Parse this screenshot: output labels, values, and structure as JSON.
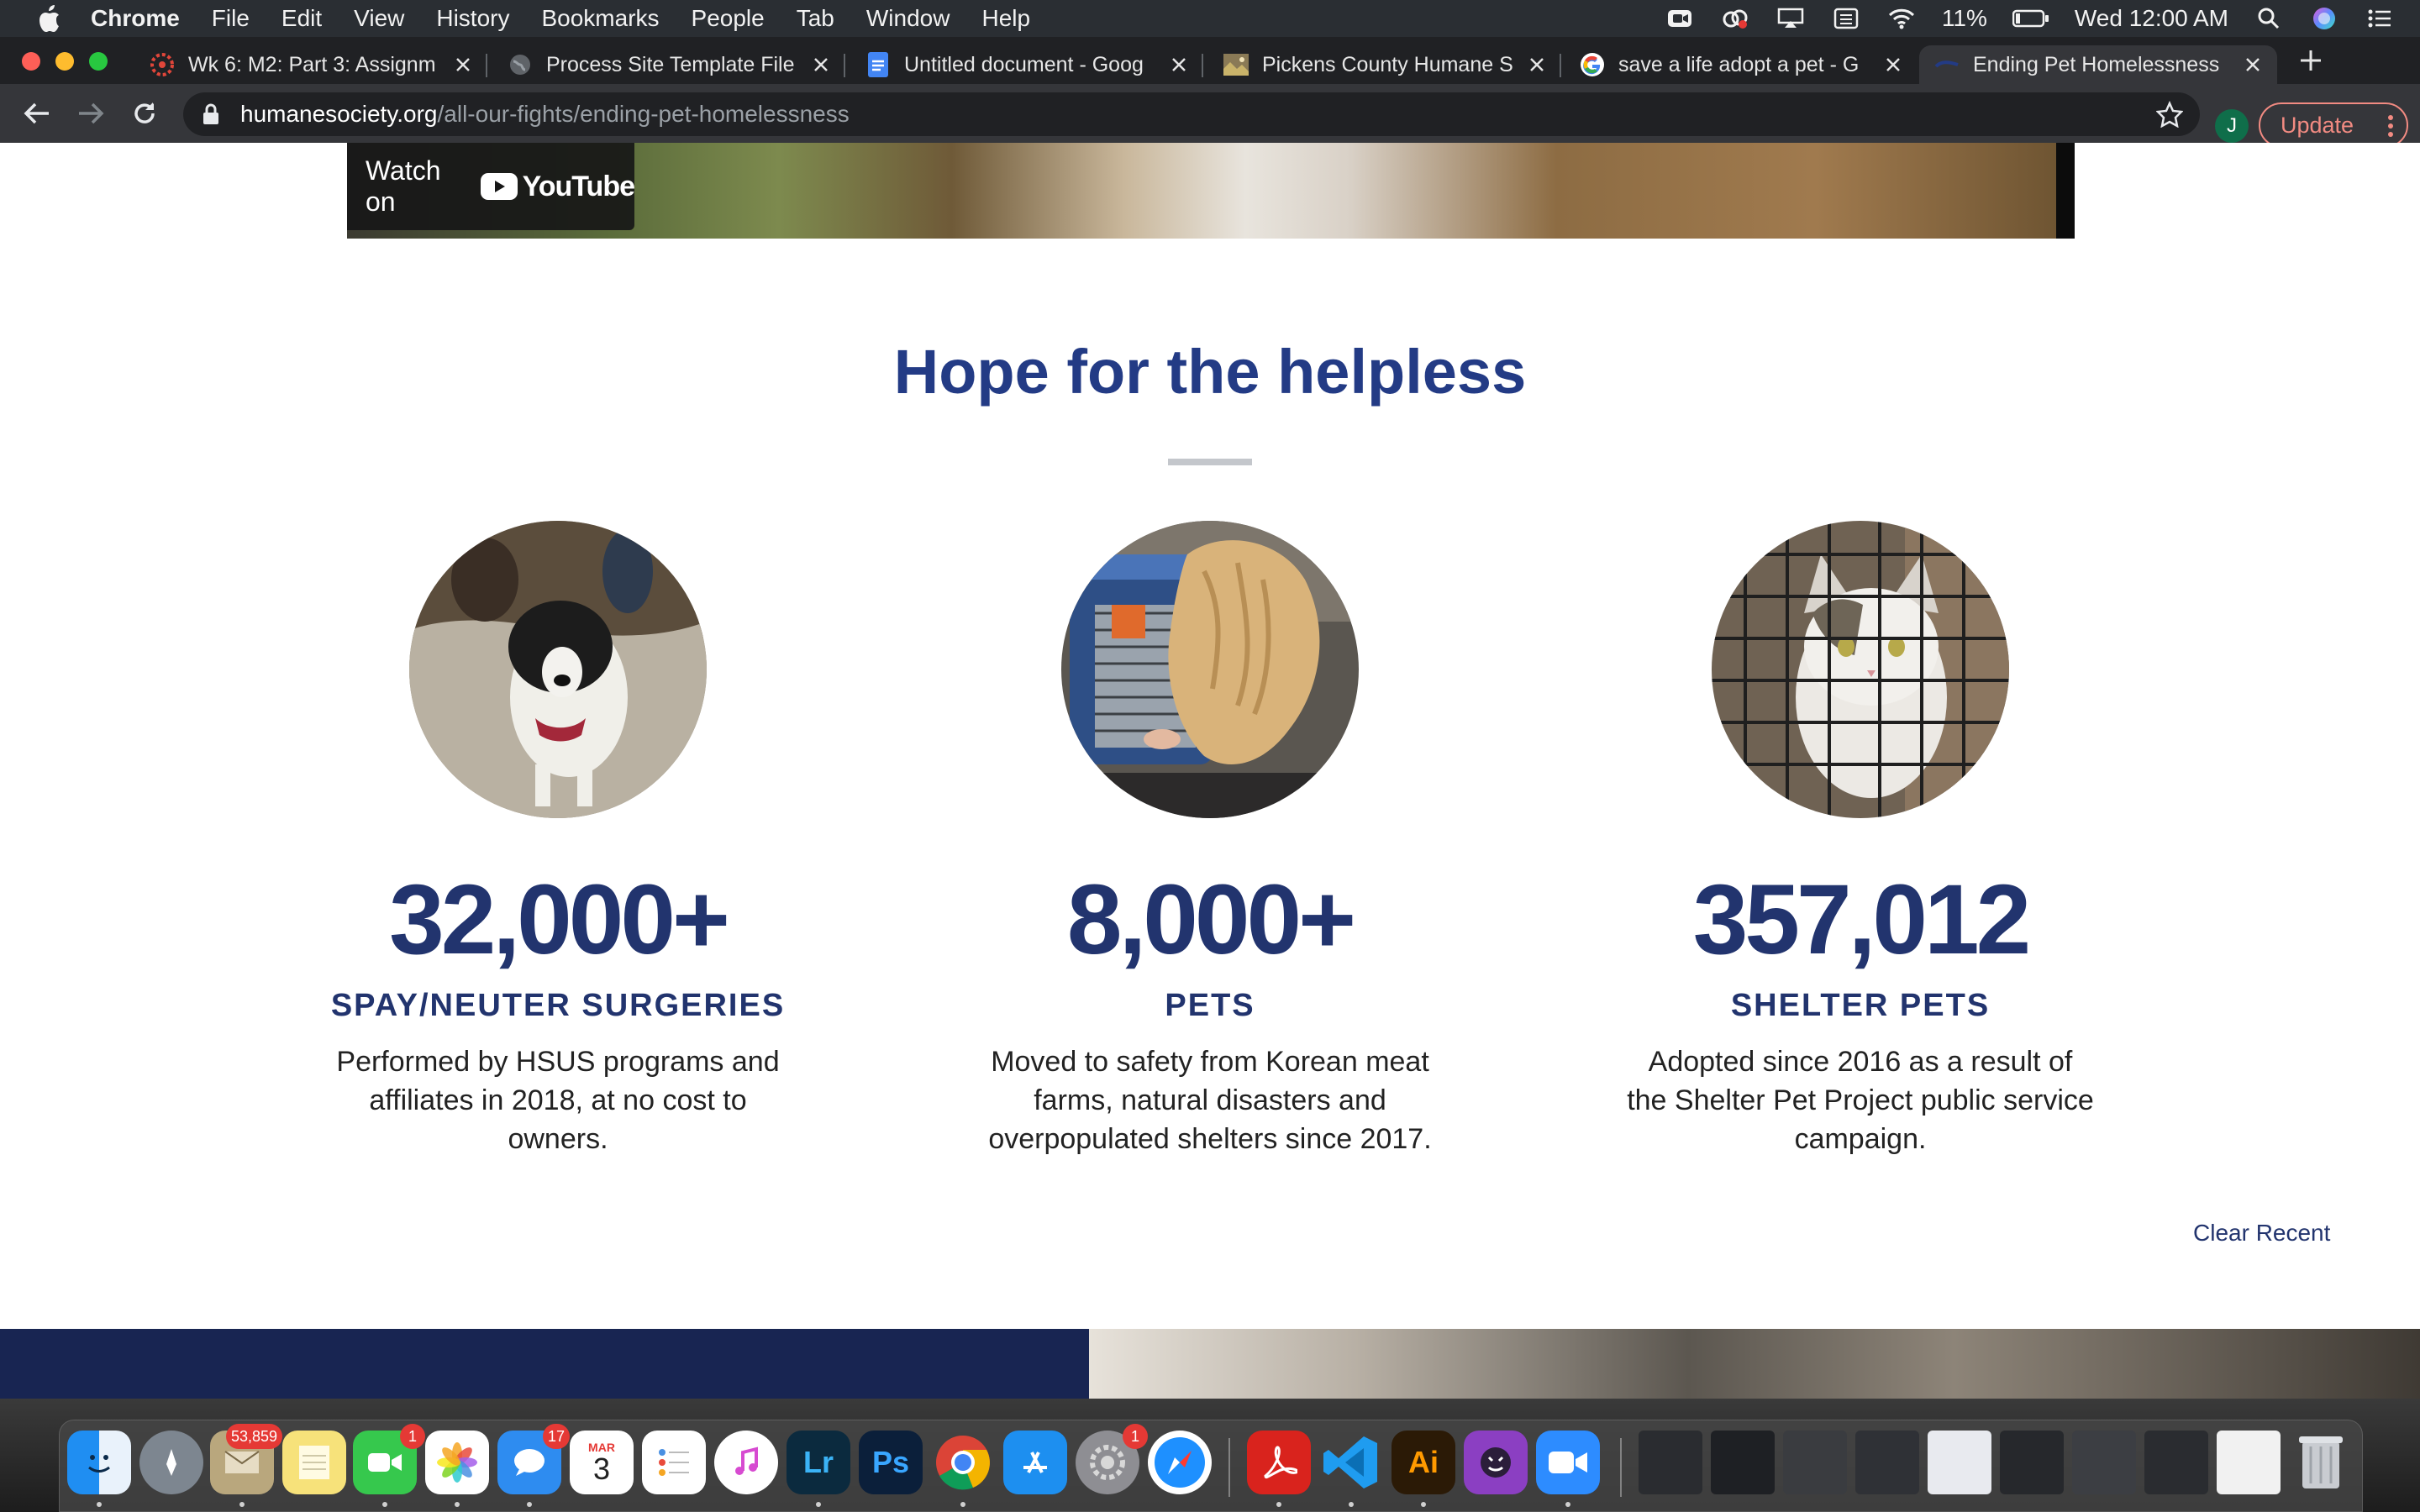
{
  "menubar": {
    "app_name": "Chrome",
    "items": [
      "File",
      "Edit",
      "View",
      "History",
      "Bookmarks",
      "People",
      "Tab",
      "Window",
      "Help"
    ],
    "battery": "11%",
    "clock": "Wed 12:00 AM"
  },
  "tabs": [
    {
      "title": "Wk 6: M2: Part 3: Assignm",
      "favicon": "canvas-icon",
      "active": false
    },
    {
      "title": "Process Site Template File",
      "favicon": "globe-icon",
      "active": false
    },
    {
      "title": "Untitled document - Goog",
      "favicon": "google-docs-icon",
      "active": false
    },
    {
      "title": "Pickens County Humane S",
      "favicon": "site-thumbnail-icon",
      "active": false
    },
    {
      "title": "save a life adopt a pet - G",
      "favicon": "google-icon",
      "active": false
    },
    {
      "title": "Ending Pet Homelessness",
      "favicon": "hsus-icon",
      "active": true
    }
  ],
  "toolbar": {
    "url_host": "humanesociety.org",
    "url_path": "/all-our-fights/ending-pet-homelessness",
    "profile_initial": "J",
    "update_label": "Update"
  },
  "video": {
    "watch_on": "Watch on",
    "youtube": "YouTube"
  },
  "section": {
    "title": "Hope for the helpless"
  },
  "stats": [
    {
      "value": "32,000+",
      "label": "SPAY/NEUTER SURGERIES",
      "description": "Performed by HSUS programs and affiliates in 2018, at no cost to owners.",
      "photo": "puppy-photo"
    },
    {
      "value": "8,000+",
      "label": "PETS",
      "description": "Moved to safety from Korean meat farms, natural disasters and overpopulated shelters since 2017.",
      "photo": "rescue-crate-photo"
    },
    {
      "value": "357,012",
      "label": "SHELTER PETS",
      "description": "Adopted since 2016 as a result of the Shelter Pet Project public service campaign.",
      "photo": "kitten-cage-photo"
    }
  ],
  "footer": {
    "clear_recent": "Clear Recent"
  },
  "dock": {
    "mail_badge": "53,859",
    "facetime_badge": "1",
    "messages_badge": "17",
    "calendar_month": "MAR",
    "calendar_day": "3",
    "prefs_badge": "1",
    "lightroom_label": "Lr",
    "photoshop_label": "Ps",
    "illustrator_label": "Ai"
  },
  "colors": {
    "heading_navy": "#233b85",
    "stat_navy": "#22346e",
    "footer_navy": "#182552",
    "update_red": "#f28b82"
  }
}
